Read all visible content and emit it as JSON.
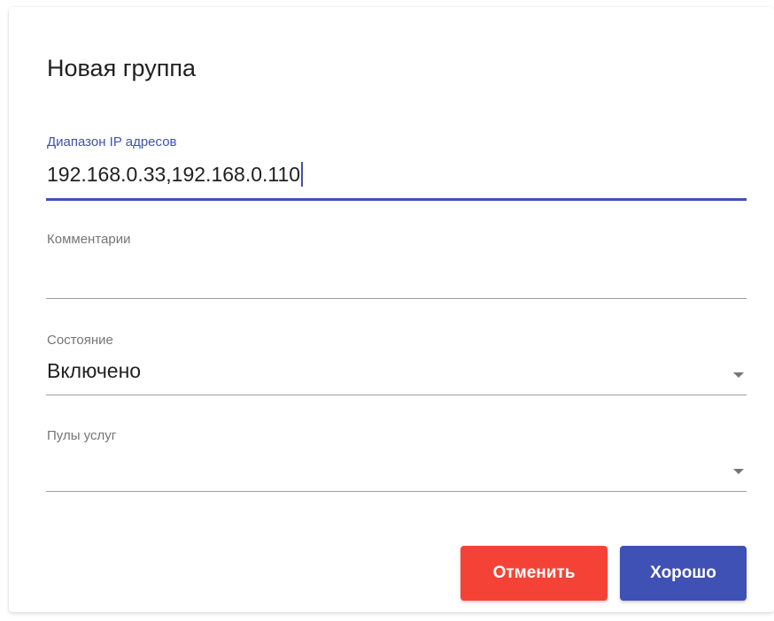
{
  "dialog": {
    "title": "Новая группа"
  },
  "fields": {
    "ip_range": {
      "label": "Диапазон IP адресов",
      "value": "192.168.0.33,192.168.0.110"
    },
    "comments": {
      "label": "Комментарии",
      "value": ""
    },
    "state": {
      "label": "Состояние",
      "value": "Включено"
    },
    "service_pools": {
      "label": "Пулы услуг",
      "value": ""
    }
  },
  "buttons": {
    "cancel_label": "Отменить",
    "ok_label": "Хорошо"
  },
  "colors": {
    "primary": "#3f51b5",
    "danger": "#f44336"
  },
  "icons": {
    "dropdown": "dropdown-arrow-icon"
  }
}
